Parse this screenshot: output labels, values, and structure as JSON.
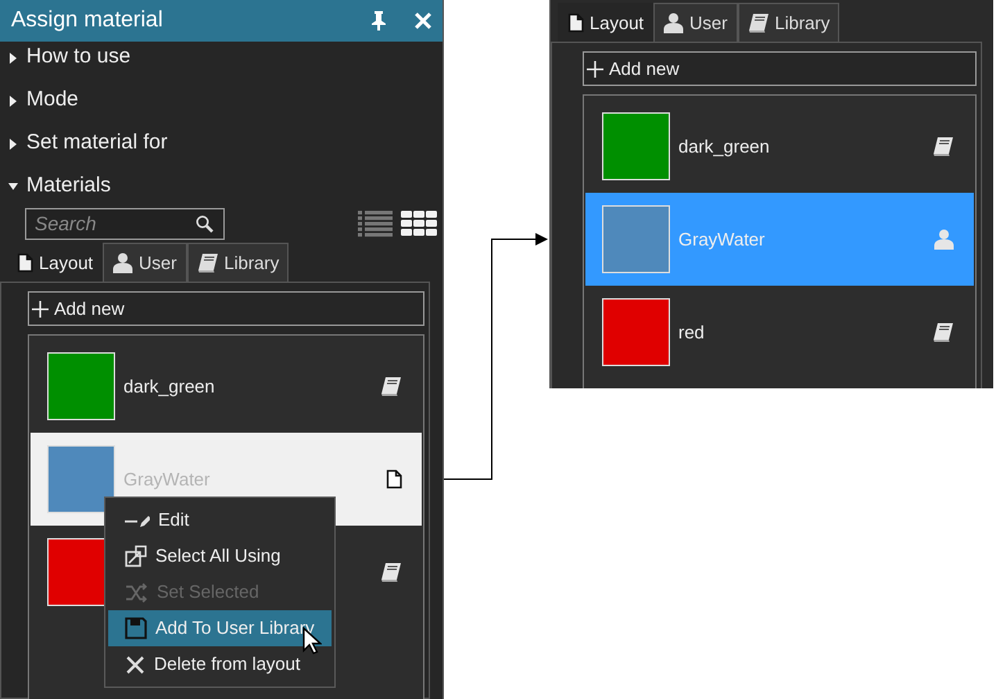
{
  "main_panel": {
    "title": "Assign material",
    "sections": [
      {
        "label": "How to use",
        "expanded": false
      },
      {
        "label": "Mode",
        "expanded": false
      },
      {
        "label": "Set material for",
        "expanded": false
      },
      {
        "label": "Materials",
        "expanded": true
      }
    ],
    "search": {
      "placeholder": "Search"
    },
    "view_modes": [
      {
        "kind": "list",
        "selected": false
      },
      {
        "kind": "grid",
        "selected": true
      }
    ],
    "tabs": [
      {
        "label": "Layout",
        "kind": "document",
        "selected": true
      },
      {
        "label": "User",
        "kind": "user",
        "selected": false
      },
      {
        "label": "Library",
        "kind": "book",
        "selected": false
      }
    ],
    "add_button": "Add new",
    "materials": [
      {
        "name": "dark_green",
        "color": "#008f00",
        "kind": "book",
        "highlighted": false
      },
      {
        "name": "GrayWater",
        "color": "#4f89bb",
        "kind": "document",
        "highlighted": true
      },
      {
        "color": "#e00000",
        "kind": "book",
        "highlighted": false
      }
    ],
    "context_menu": [
      {
        "label": "Edit",
        "kind": "pencil",
        "disabled": false,
        "selected": false
      },
      {
        "label": "Select All Using",
        "kind": "select",
        "disabled": false,
        "selected": false
      },
      {
        "label": "Set Selected",
        "kind": "shuffle",
        "disabled": true,
        "selected": false
      },
      {
        "label": "Add To User Library",
        "kind": "floppy",
        "disabled": false,
        "selected": true
      },
      {
        "label": "Delete from layout",
        "kind": "delete",
        "disabled": false,
        "selected": false
      }
    ]
  },
  "inset_panel": {
    "tabs": [
      {
        "label": "Layout",
        "kind": "document",
        "selected": true
      },
      {
        "label": "User",
        "kind": "user",
        "selected": false
      },
      {
        "label": "Library",
        "kind": "book",
        "selected": false
      }
    ],
    "add_button": "Add new",
    "materials": [
      {
        "name": "dark_green",
        "color": "#008f00",
        "kind": "book",
        "selected": false
      },
      {
        "name": "GrayWater",
        "color": "#4f89bb",
        "kind": "user",
        "selected": true
      },
      {
        "name": "red",
        "color": "#e00000",
        "kind": "book",
        "selected": false
      }
    ]
  }
}
